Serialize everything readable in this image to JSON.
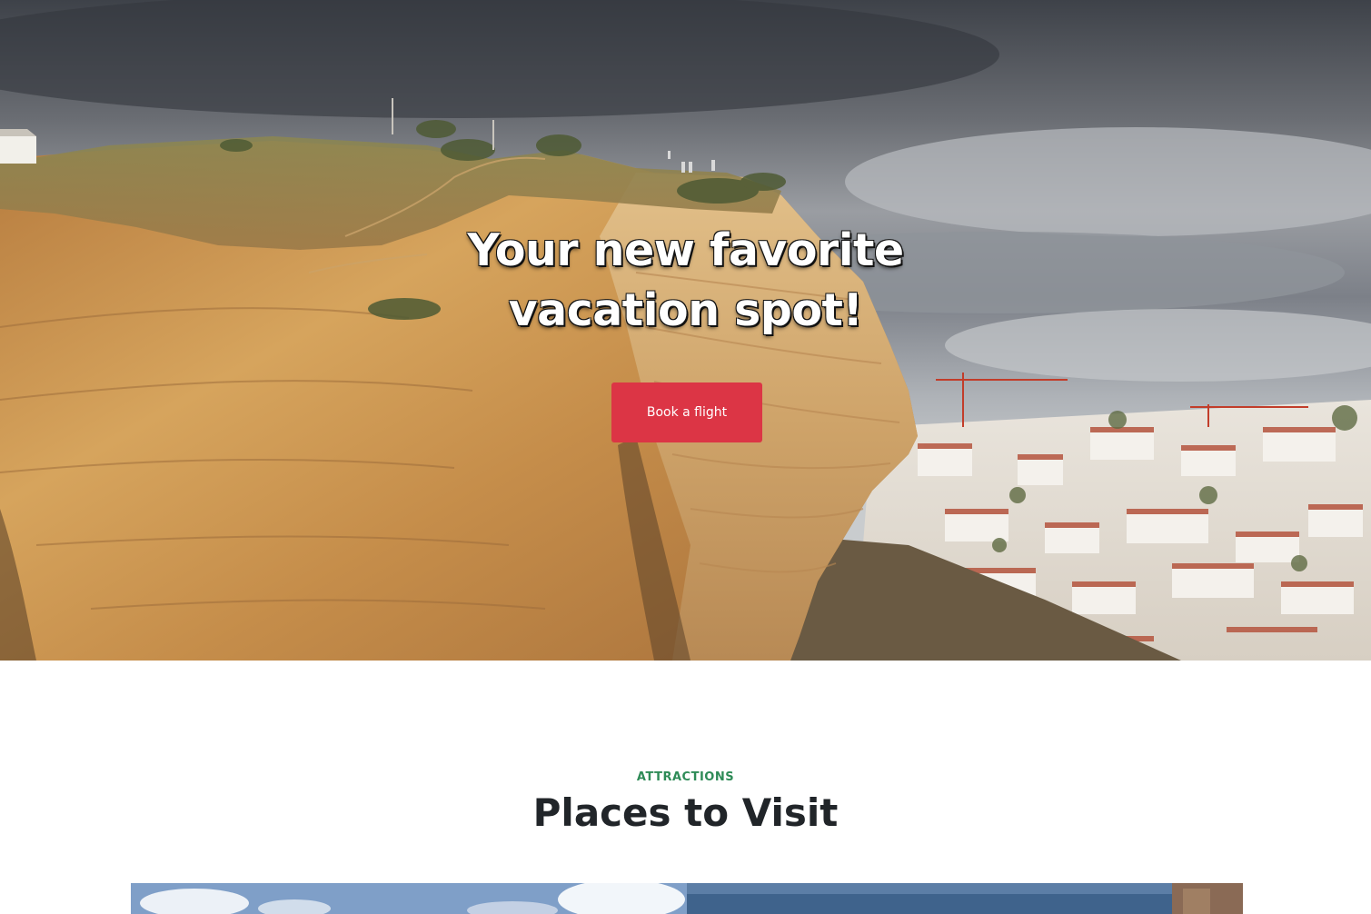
{
  "hero": {
    "title_line_1": "Your new favorite",
    "title_line_2": "vacation spot!",
    "cta_label": "Book a flight",
    "cta_color": "#dc3545"
  },
  "attractions": {
    "eyebrow": "ATTRACTIONS",
    "title": "Places to Visit",
    "eyebrow_color": "#2e8b57"
  }
}
